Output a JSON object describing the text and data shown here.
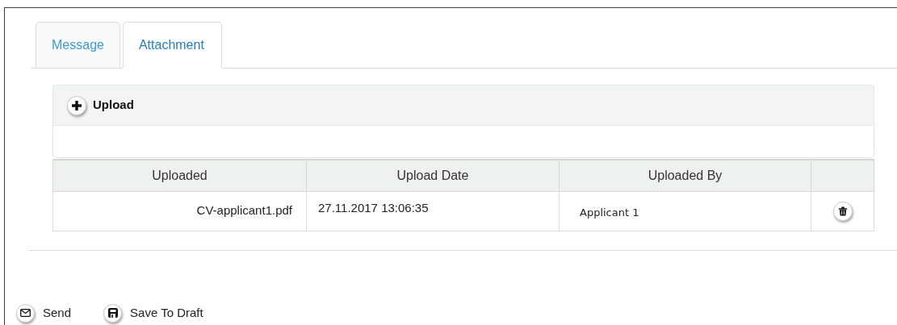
{
  "tabs": [
    {
      "label": "Message",
      "selected": false
    },
    {
      "label": "Attachment",
      "selected": true
    }
  ],
  "upload_button": {
    "label": "Upload"
  },
  "table": {
    "columns": [
      "Uploaded",
      "Upload Date",
      "Uploaded By"
    ],
    "rows": [
      {
        "file": "CV-applicant1.pdf",
        "date": "27.11.2017 13:06:35",
        "by": "Applicant 1"
      }
    ]
  },
  "actions": [
    {
      "kind": "send",
      "label": "Send"
    },
    {
      "kind": "draft",
      "label": "Save To Draft"
    }
  ]
}
